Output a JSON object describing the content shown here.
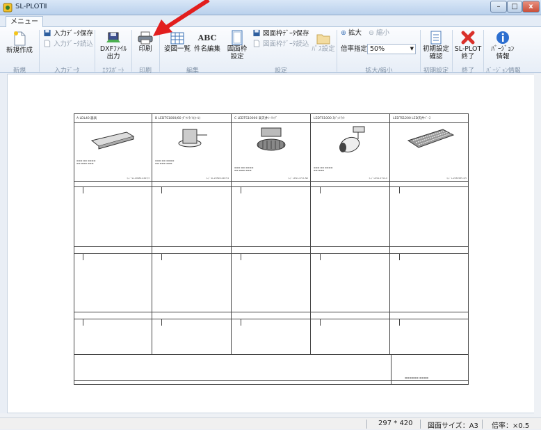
{
  "window": {
    "title": "SL-PLOTⅡ",
    "minimize": "–",
    "maximize": "□",
    "close": "x"
  },
  "tabs": [
    {
      "label": "メニュー"
    }
  ],
  "ribbon": {
    "new": {
      "label": "新規作成",
      "icon": "new-document-icon"
    },
    "save_input": {
      "label": "入力ﾃﾞｰﾀ保存",
      "icon": "save-icon"
    },
    "load_input": {
      "label": "入力ﾃﾞｰﾀ読込",
      "icon": "open-icon"
    },
    "dxf_output": {
      "label1": "DXFﾌｧｲﾙ",
      "label2": "出力",
      "icon": "dxf-export-icon"
    },
    "print": {
      "label": "印刷",
      "icon": "printer-icon"
    },
    "drawing_list": {
      "label": "姿図一覧",
      "icon": "grid-list-icon"
    },
    "name_edit": {
      "label": "件名編集",
      "icon_text": "ABC"
    },
    "frame_setting": {
      "label1": "図面枠",
      "label2": "設定",
      "icon": "frame-icon"
    },
    "save_frame": {
      "label": "図面枠ﾃﾞｰﾀ保存",
      "icon": "save-icon"
    },
    "load_frame": {
      "label": "図面枠ﾃﾞｰﾀ読込",
      "icon": "open-icon"
    },
    "path_setting": {
      "label": "ﾊﾟｽ設定",
      "icon": "folder-icon"
    },
    "zoom_in": {
      "label": "拡大",
      "icon": "zoom-in-icon"
    },
    "zoom_out": {
      "label": "縮小",
      "icon": "zoom-out-icon"
    },
    "zoom_ratio": {
      "label": "倍率指定",
      "value": "50%"
    },
    "initial_setting": {
      "label1": "初期設定",
      "label2": "確認",
      "icon": "checklist-icon"
    },
    "exit": {
      "label1": "SL-PLOT",
      "label2": "終了",
      "icon": "close-x-icon"
    },
    "version": {
      "label1": "ﾊﾞｰｼﾞｮﾝ",
      "label2": "情報",
      "icon": "info-icon"
    }
  },
  "groups": {
    "new": "新規",
    "input": "入力ﾃﾞｰﾀ",
    "export": "ｴｸｽﾎﾟｰﾄ",
    "print": "印刷",
    "edit": "編集",
    "settings": "設定",
    "zoom": "拡大/縮小",
    "initial": "初期設定",
    "exit": "終了",
    "version": "ﾊﾞｰｼﾞｮﾝ情報"
  },
  "sheet": {
    "columns": [
      {
        "label": "A  LDL40 器具",
        "code": "ｺｰﾄﾞ SL-20682-4497/3"
      },
      {
        "label": "B  LEDTS1000/60 ﾀﾞｳﾝﾗｲﾄ(ﾎｰﾙ)",
        "code": "ｺｰﾄﾞ SL-20598-4497/4"
      },
      {
        "label": "C  LEDTS10000 高天井ｼｰﾘﾝｸﾞ",
        "code": "ｺｰﾄﾞ LDS1-4711-N0"
      },
      {
        "label": "LEDTS1000 ｽﾎﾟｯﾄﾗｲﾄ",
        "code": "ｺｰﾄﾞ LDS1-2712-0"
      },
      {
        "label": "LEDTS1200 LED天井ﾍﾞｰｽ",
        "code": "ｺｰﾄﾞ L-2034585-4/5"
      }
    ]
  },
  "status": {
    "dimensions": "297 * 420",
    "size": "図面サイズ：A3",
    "ratio": "倍率：×0.5"
  }
}
